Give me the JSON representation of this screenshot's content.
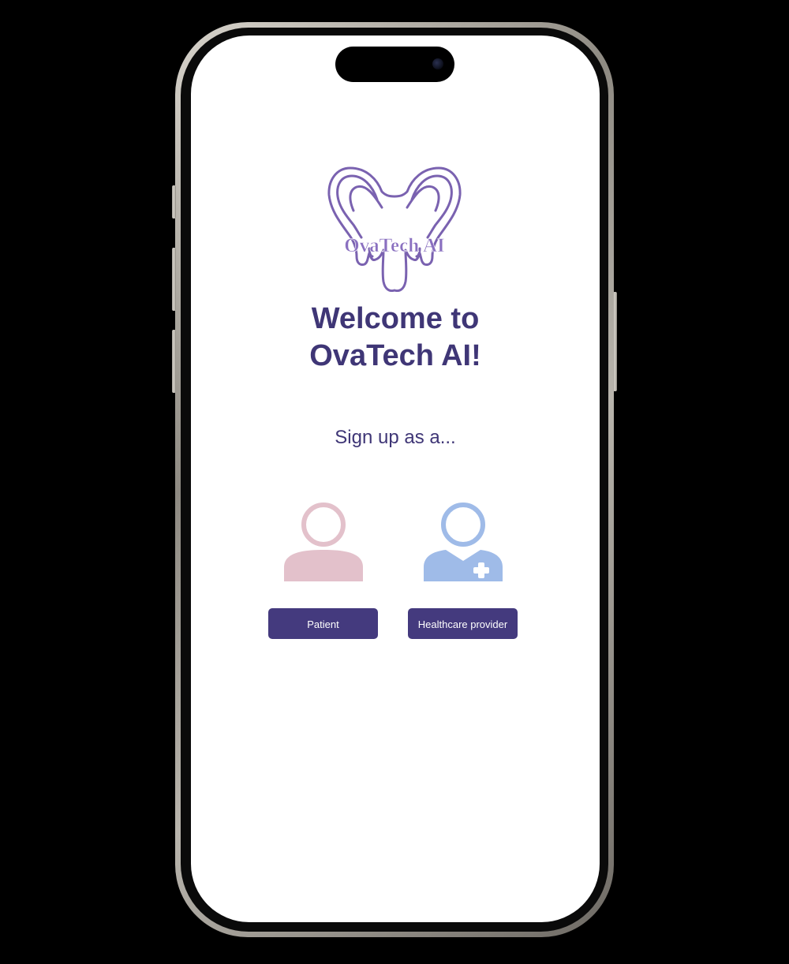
{
  "app": {
    "logo_text": "OvaTech AI",
    "welcome_title": "Welcome to\nOvaTech AI!",
    "signup_prompt": "Sign up as a..."
  },
  "roles": [
    {
      "label": "Patient",
      "icon": "patient-icon",
      "color": "#e3c1cb"
    },
    {
      "label": "Healthcare provider",
      "icon": "healthcare-provider-icon",
      "color": "#9fbbe8"
    }
  ],
  "colors": {
    "brand_text": "#3f3676",
    "button_bg": "#443a7e",
    "logo_stroke": "#7a62b0"
  }
}
